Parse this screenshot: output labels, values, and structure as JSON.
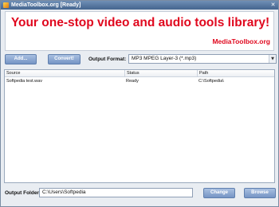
{
  "window": {
    "title": "MediaToolbox.org [Ready]",
    "close_glyph": "✕"
  },
  "banner": {
    "headline": "Your one-stop video and audio tools library!",
    "site": "MediaToolbox.org",
    "accent_color": "#e0081e"
  },
  "toolbar": {
    "add_label": "Add...",
    "convert_label": "Convert!",
    "format_label": "Output Format:",
    "format_value": "MP3 MPEG Layer-3 (*.mp3)",
    "dropdown_glyph": "▼"
  },
  "file_list": {
    "columns": [
      "Source",
      "Status",
      "Path"
    ],
    "rows": [
      {
        "source": "Softpedia test.wav",
        "status": "Ready",
        "path": "C:\\Softpedia\\"
      }
    ]
  },
  "output": {
    "folder_label": "Output Folder:",
    "folder_value": "C:\\Users\\Softpedia",
    "change_label": "Change",
    "browse_label": "Browse"
  }
}
